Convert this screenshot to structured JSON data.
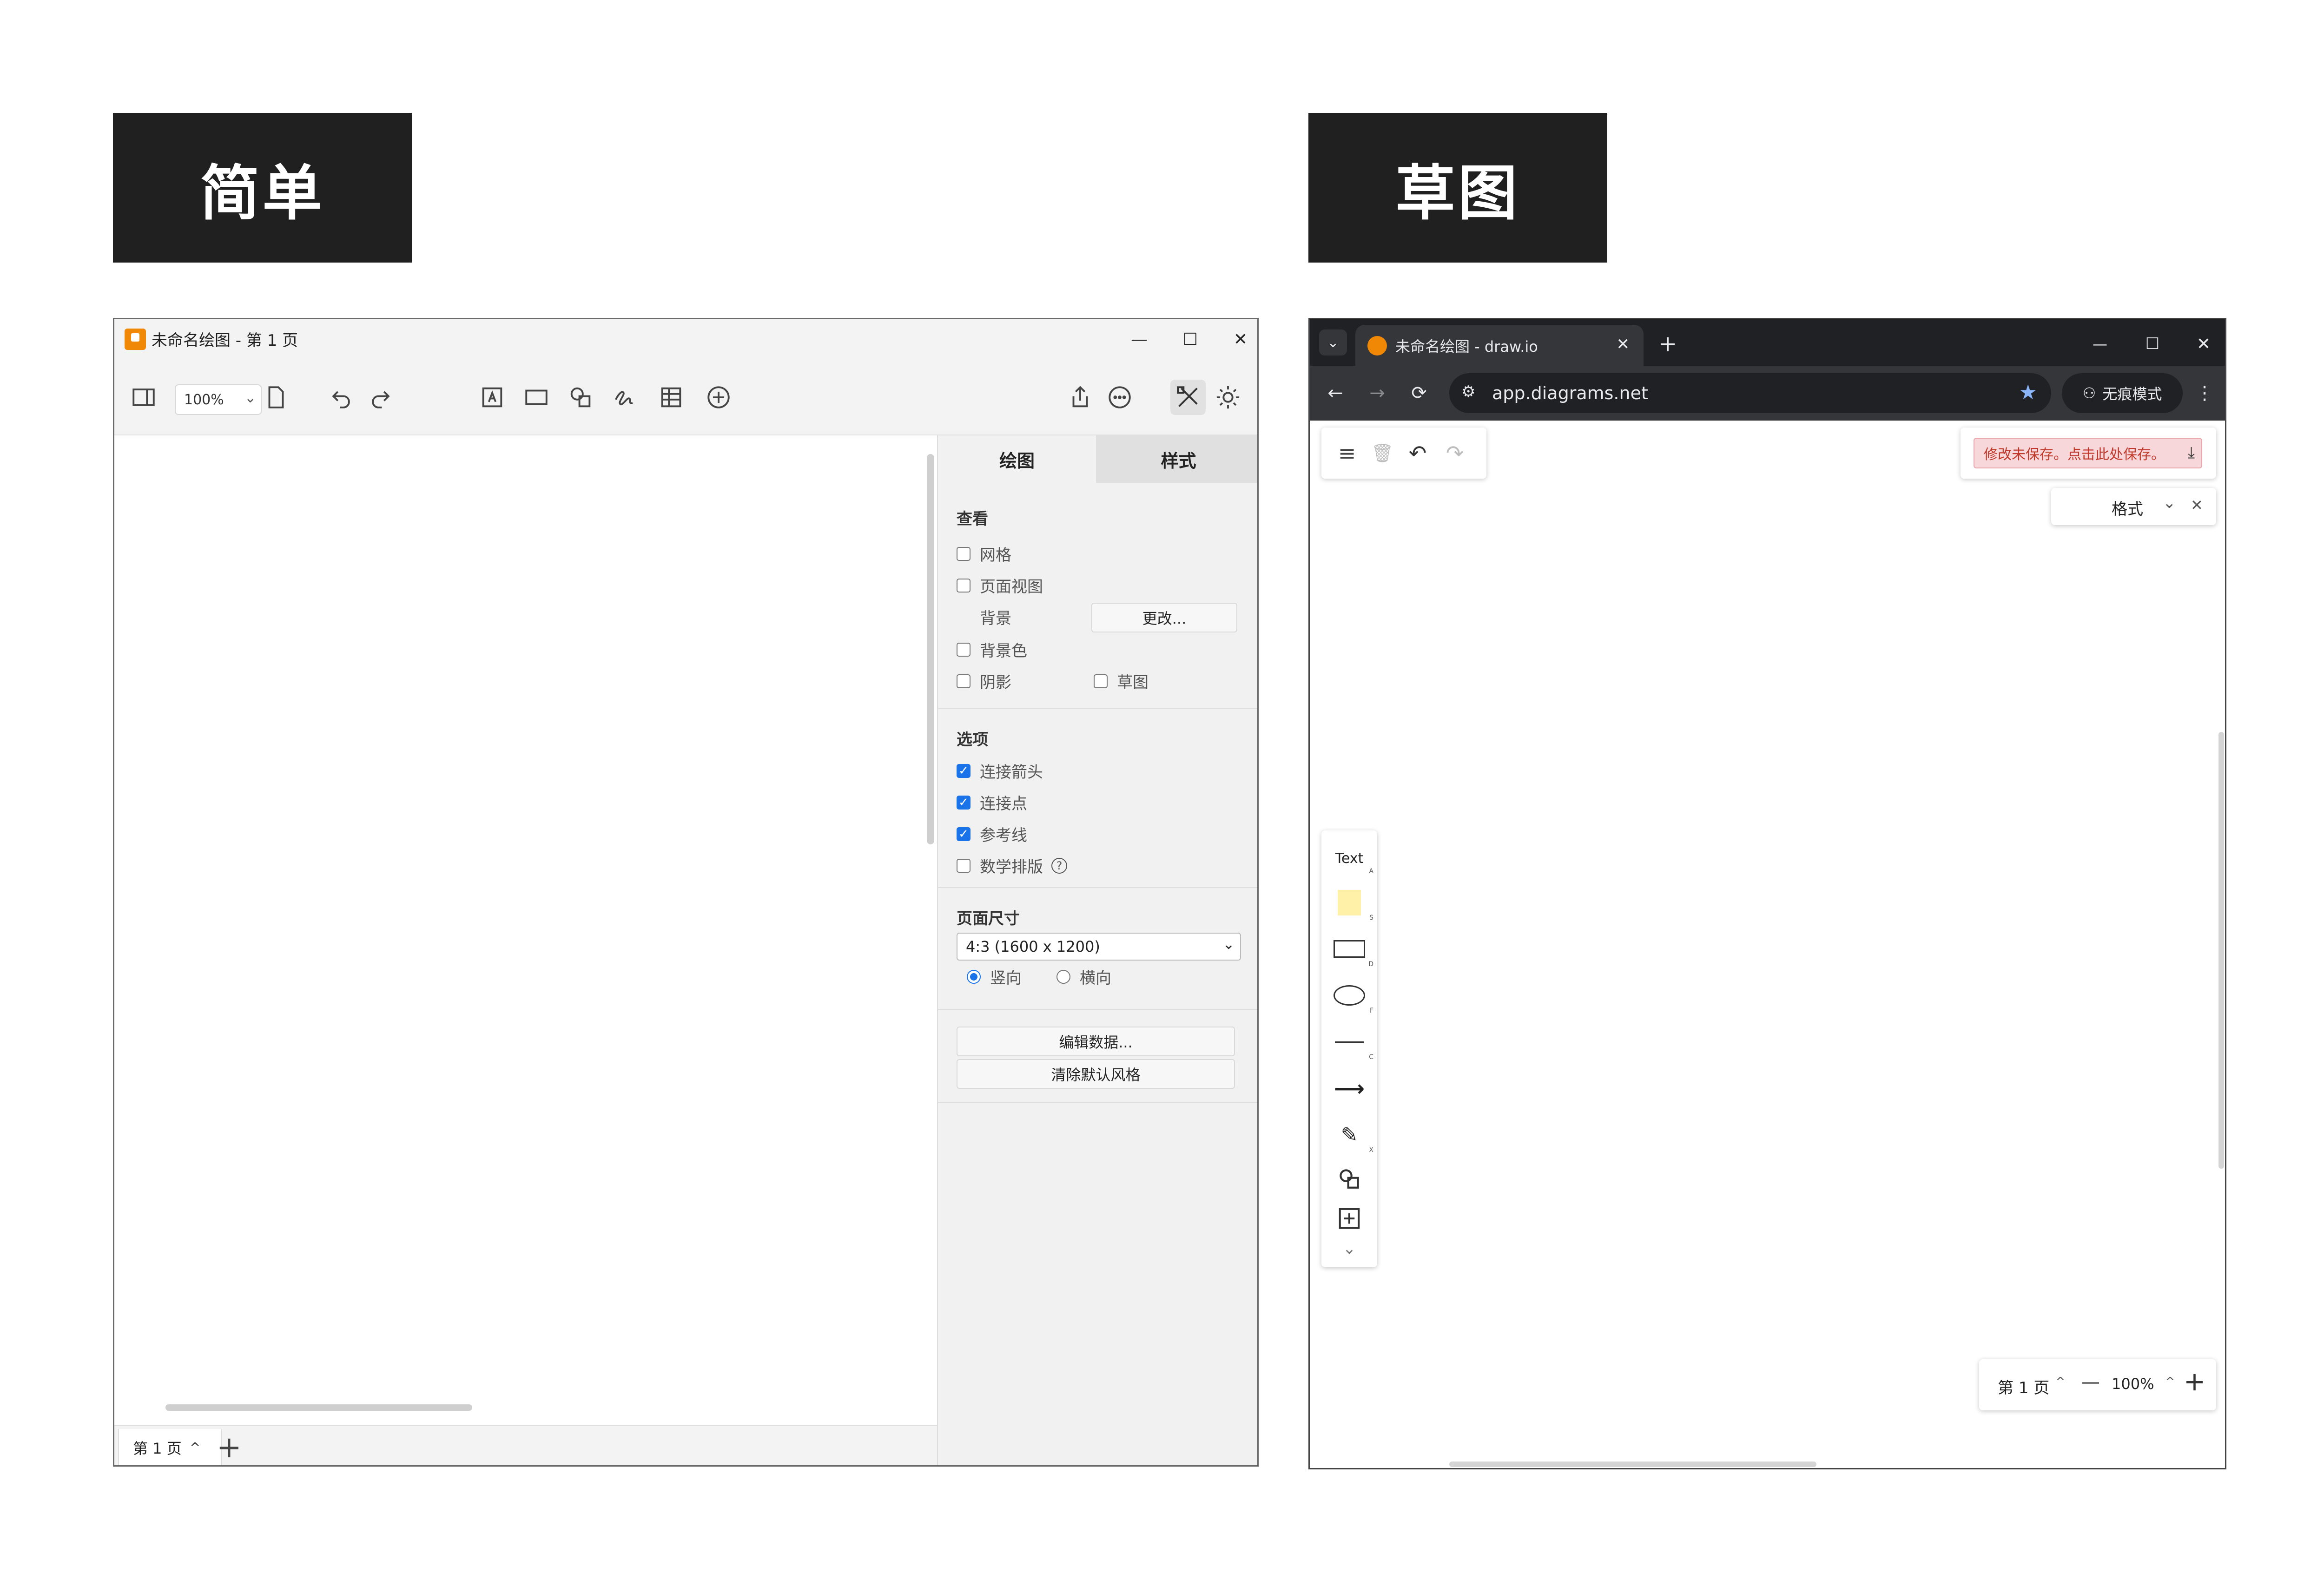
{
  "labels": {
    "left": "简单",
    "right": "草图"
  },
  "simple": {
    "window_title": "未命名绘图 - 第 1 页",
    "window_controls": {
      "minimize": "—",
      "maximize": "☐",
      "close": "✕"
    },
    "zoom": "100%",
    "zoom_chevron": "⌄",
    "panel": {
      "tabs": [
        "绘图",
        "样式"
      ],
      "view": {
        "heading": "查看",
        "grid": "网格",
        "page_view": "页面视图",
        "background_label": "背景",
        "change_button": "更改...",
        "background_color": "背景色",
        "shadow": "阴影",
        "sketch": "草图"
      },
      "options": {
        "heading": "选项",
        "connect_arrows": "连接箭头",
        "connection_points": "连接点",
        "guides": "参考线",
        "math_typesetting": "数学排版",
        "help": "?"
      },
      "page_size": {
        "heading": "页面尺寸",
        "selected": "4:3 (1600 x 1200)",
        "portrait": "竖向",
        "landscape": "横向"
      },
      "edit_data_button": "编辑数据...",
      "clear_style_button": "清除默认风格"
    },
    "page_tab": "第 1 页",
    "page_tab_chevron": "^",
    "add_page": "+"
  },
  "sketch": {
    "tab_title": "未命名绘图 - draw.io",
    "tab_close": "✕",
    "new_tab": "+",
    "url": "app.diagrams.net",
    "incognito": "无痕模式",
    "unsaved_notice": "修改未保存。点击此处保存。",
    "format_label": "格式",
    "format_chevron": "⌄",
    "format_close": "✕",
    "tools": [
      {
        "label": "Text",
        "shortcut": "A"
      },
      {
        "label": "",
        "shortcut": "S"
      },
      {
        "label": "",
        "shortcut": "D"
      },
      {
        "label": "",
        "shortcut": "F"
      },
      {
        "label": "",
        "shortcut": "C"
      },
      {
        "label": "",
        "shortcut": ""
      },
      {
        "label": "",
        "shortcut": "X"
      }
    ],
    "page_label": "第 1 页",
    "page_chevron": "^",
    "zoom_out": "—",
    "zoom": "100%",
    "zoom_chevron": "^",
    "zoom_in": "+",
    "window_controls": {
      "minimize": "—",
      "maximize": "☐",
      "close": "✕"
    }
  }
}
